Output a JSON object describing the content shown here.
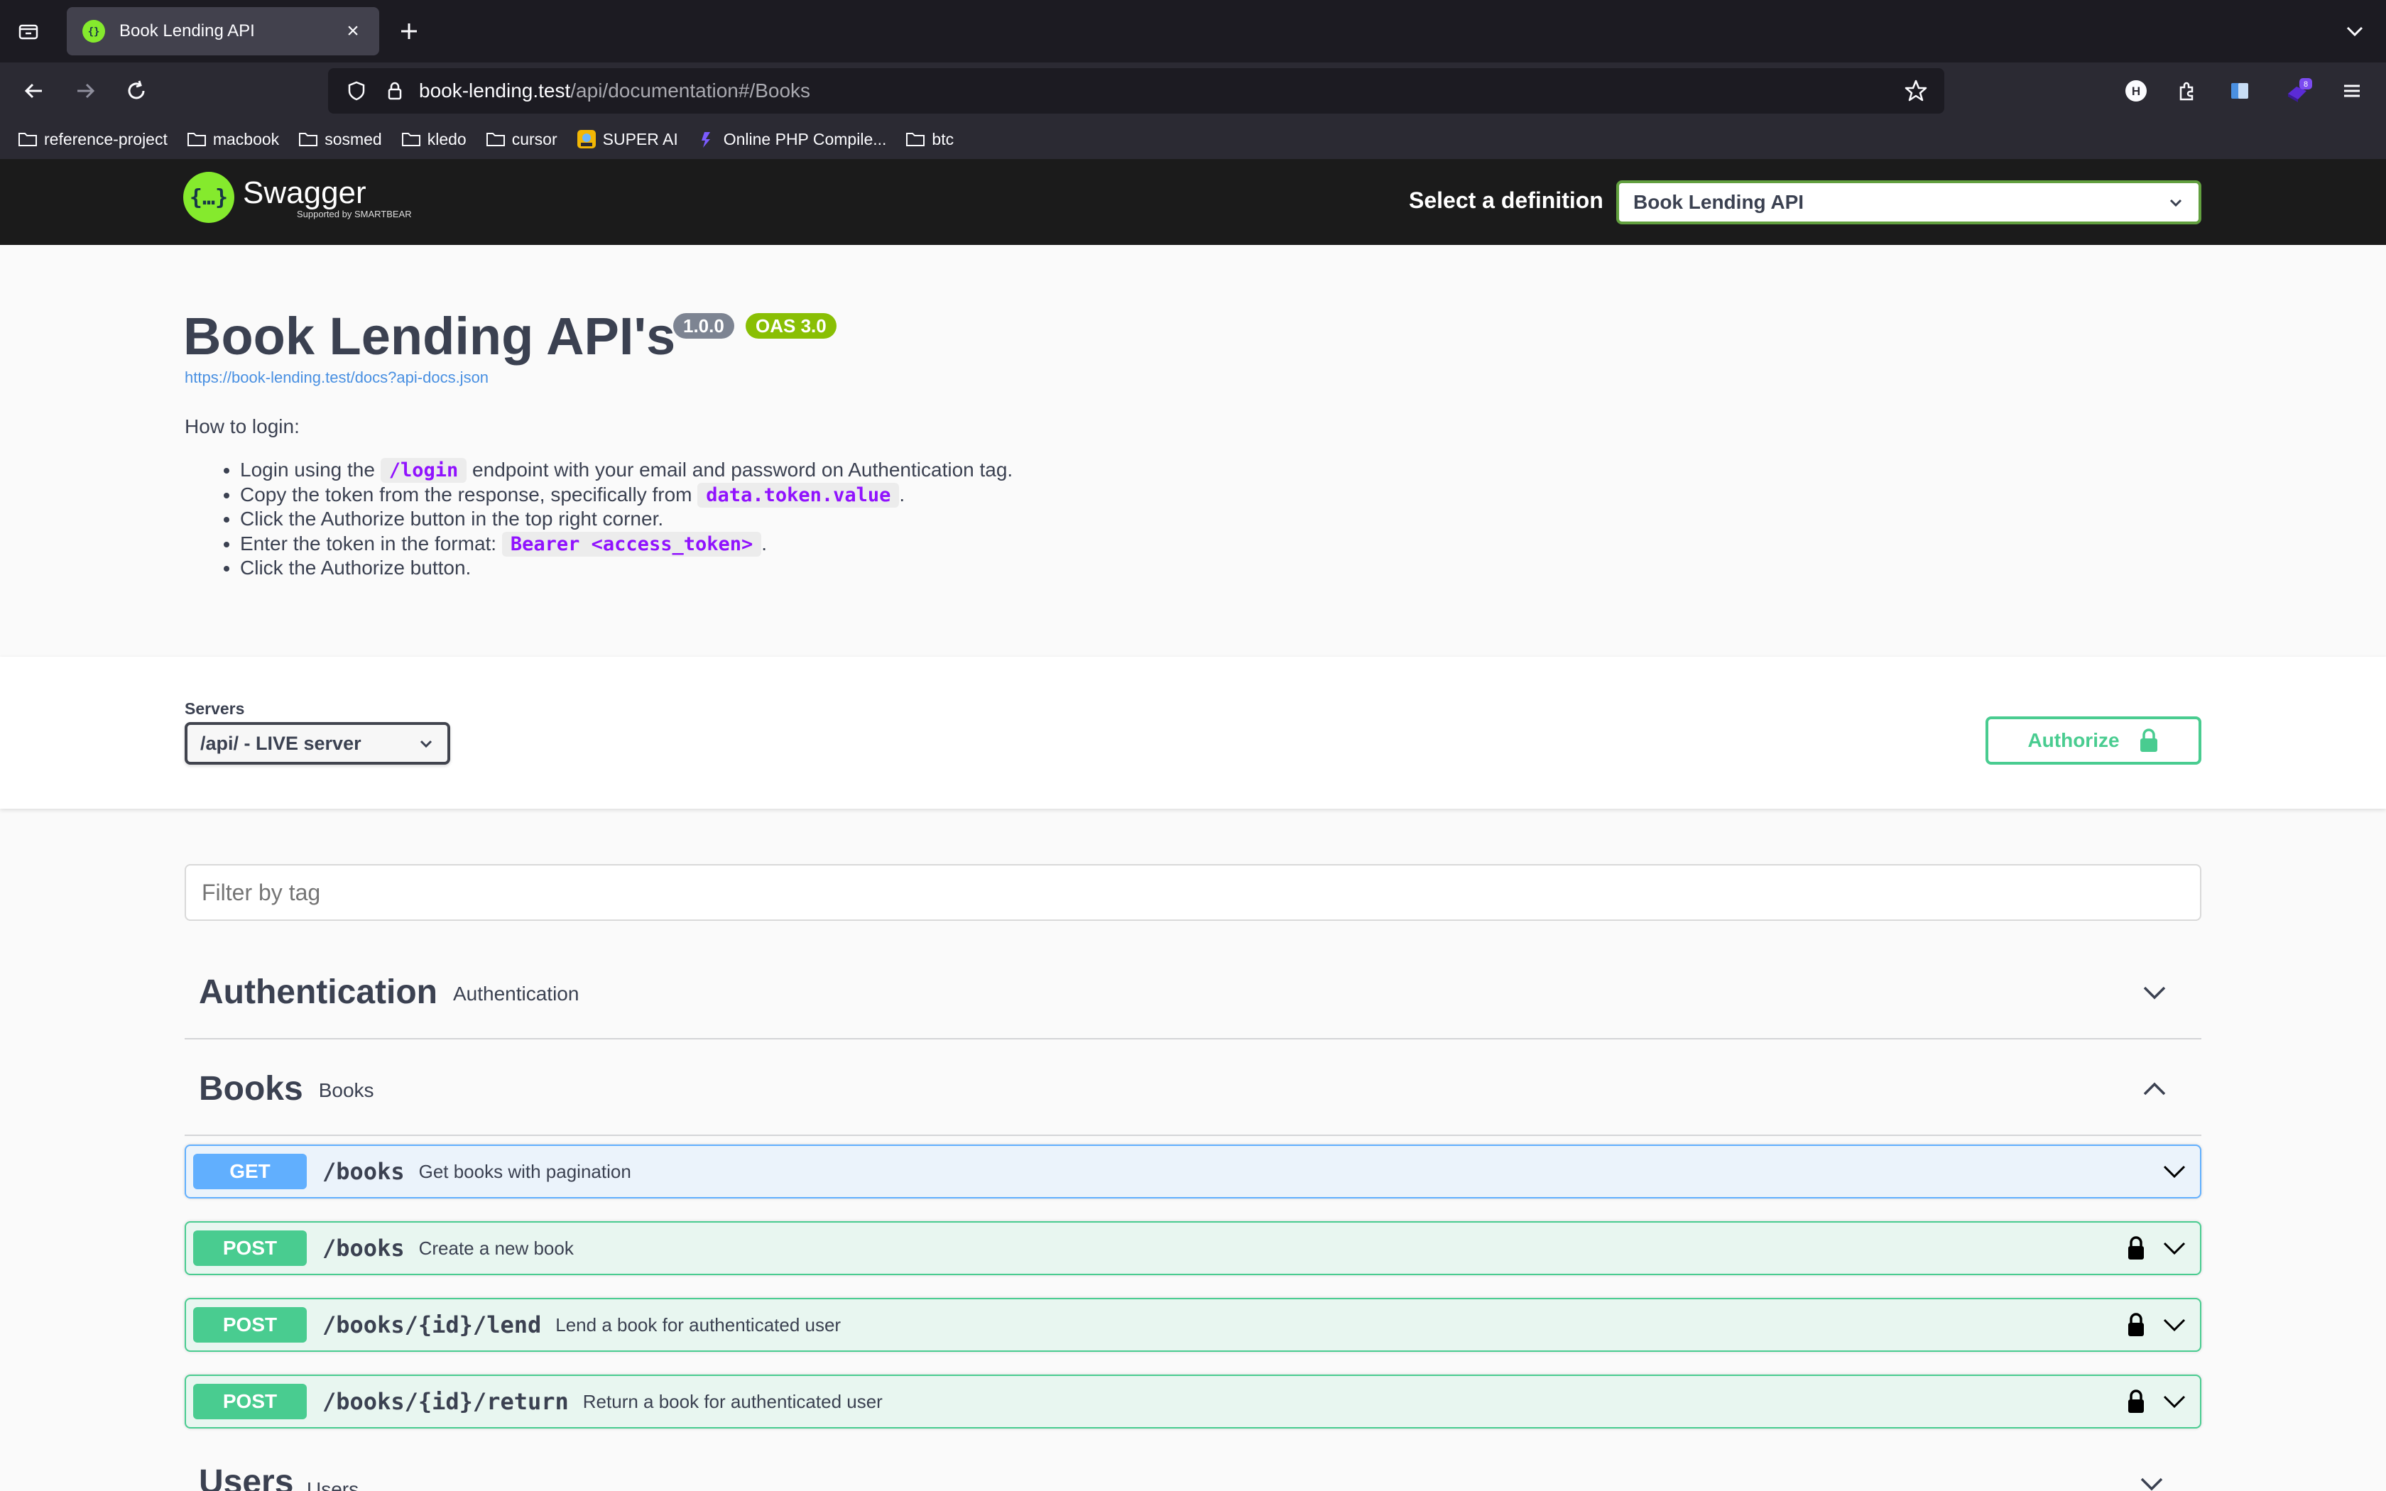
{
  "browser": {
    "tab_title": "Book Lending API",
    "url_host": "book-lending.test",
    "url_path": "/api/documentation#/Books",
    "extension_badge": "8",
    "bookmarks": [
      {
        "label": "reference-project",
        "icon": "folder-icon"
      },
      {
        "label": "macbook",
        "icon": "folder-icon"
      },
      {
        "label": "sosmed",
        "icon": "folder-icon"
      },
      {
        "label": "kledo",
        "icon": "folder-icon"
      },
      {
        "label": "cursor",
        "icon": "folder-icon"
      },
      {
        "label": "SUPER AI",
        "icon": "super-ai-icon"
      },
      {
        "label": "Online PHP Compile...",
        "icon": "php-compiler-icon"
      },
      {
        "label": "btc",
        "icon": "folder-icon"
      }
    ]
  },
  "swagger": {
    "logo_text": "Swagger",
    "logo_sub": "Supported by SMARTBEAR",
    "definition_label": "Select a definition",
    "definition_value": "Book Lending API"
  },
  "info": {
    "title": "Book Lending API's",
    "version": "1.0.0",
    "oas": "OAS 3.0",
    "spec_url": "https://book-lending.test/docs?api-docs.json",
    "howto": "How to login:",
    "steps": [
      {
        "pre": "Login using the ",
        "code": "/login",
        "post": " endpoint with your email and password on Authentication tag."
      },
      {
        "pre": "Copy the token from the response, specifically from ",
        "code": "data.token.value",
        "post": "."
      },
      {
        "pre": "Click the Authorize button in the top right corner.",
        "code": "",
        "post": ""
      },
      {
        "pre": "Enter the token in the format: ",
        "code": "Bearer <access_token>",
        "post": "."
      },
      {
        "pre": "Click the Authorize button.",
        "code": "",
        "post": ""
      }
    ]
  },
  "servers": {
    "label": "Servers",
    "value": "/api/ - LIVE server"
  },
  "authorize_label": "Authorize",
  "filter_placeholder": "Filter by tag",
  "tags": [
    {
      "name": "Authentication",
      "desc": "Authentication",
      "expanded": false
    },
    {
      "name": "Books",
      "desc": "Books",
      "expanded": true
    },
    {
      "name": "Users",
      "desc": "Users",
      "expanded": false
    }
  ],
  "operations": [
    {
      "method": "GET",
      "path": "/books",
      "summary": "Get books with pagination",
      "locked": false
    },
    {
      "method": "POST",
      "path": "/books",
      "summary": "Create a new book",
      "locked": true
    },
    {
      "method": "POST",
      "path": "/books/{id}/lend",
      "summary": "Lend a book for authenticated user",
      "locked": true
    },
    {
      "method": "POST",
      "path": "/books/{id}/return",
      "summary": "Return a book for authenticated user",
      "locked": true
    }
  ],
  "colors": {
    "get": "#61affe",
    "post": "#49cc90",
    "swagger_green": "#85ea2d",
    "topbar": "#1b1b1b"
  }
}
